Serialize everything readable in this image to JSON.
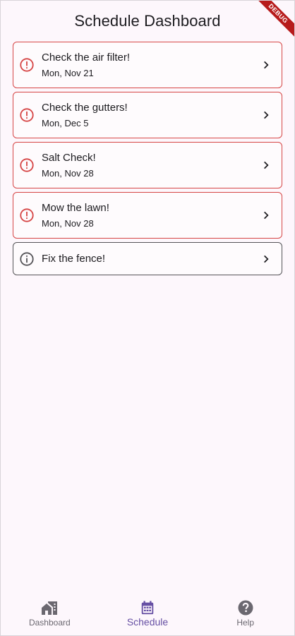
{
  "app_bar": {
    "title": "Schedule Dashboard",
    "debug_label": "DEBUG"
  },
  "colors": {
    "overdue": "#d64545",
    "info": "#555458",
    "accent": "#6750a4",
    "nav_inactive": "#6b6870"
  },
  "tasks": [
    {
      "title": "Check the air filter!",
      "date": "Mon, Nov 21",
      "status": "overdue",
      "icon": "error-outline-icon"
    },
    {
      "title": "Check the gutters!",
      "date": "Mon, Dec 5",
      "status": "overdue",
      "icon": "error-outline-icon"
    },
    {
      "title": "Salt Check!",
      "date": "Mon, Nov 28",
      "status": "overdue",
      "icon": "error-outline-icon"
    },
    {
      "title": "Mow the lawn!",
      "date": "Mon, Nov 28",
      "status": "overdue",
      "icon": "error-outline-icon"
    },
    {
      "title": "Fix the fence!",
      "date": "",
      "status": "info",
      "icon": "info-outline-icon"
    }
  ],
  "bottom_nav": {
    "items": [
      {
        "label": "Dashboard",
        "icon": "home-work-icon",
        "active": false
      },
      {
        "label": "Schedule",
        "icon": "calendar-icon",
        "active": true
      },
      {
        "label": "Help",
        "icon": "help-icon",
        "active": false
      }
    ]
  }
}
